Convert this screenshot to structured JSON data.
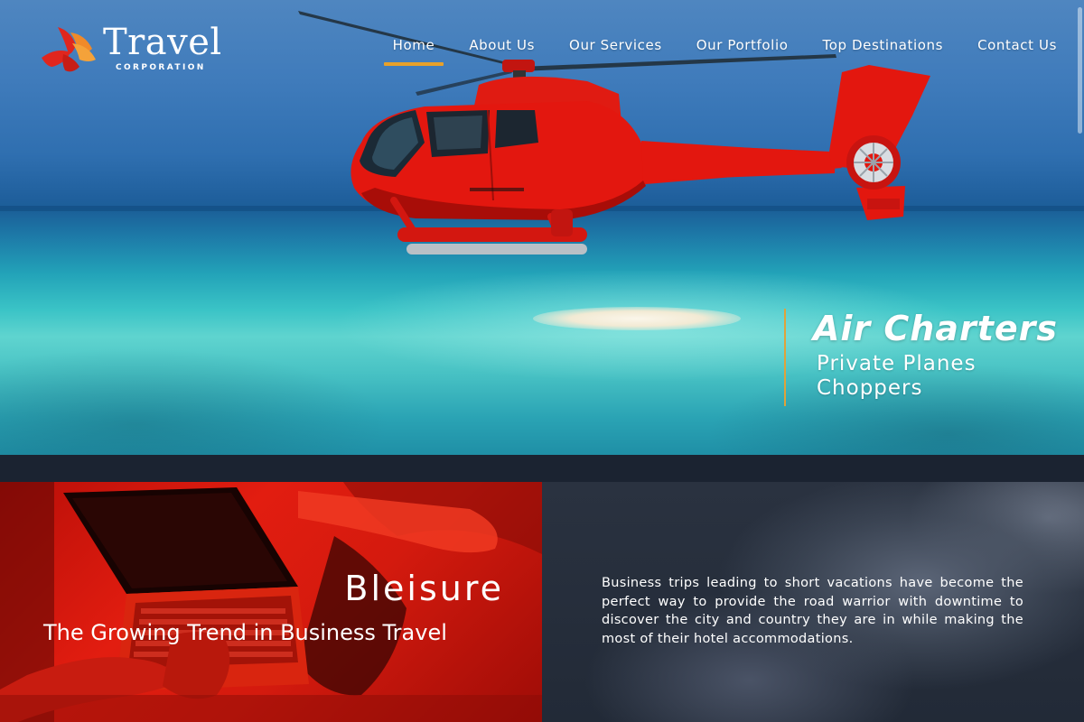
{
  "brand": {
    "name": "Travel",
    "tagline": "CORPORATION",
    "colors": {
      "logo_red": "#e0261e",
      "logo_orange": "#f08a2a",
      "accent_gold": "#e8a12a",
      "panel_red": "#e21d10",
      "dark_bg": "#1b2331"
    }
  },
  "nav": {
    "items": [
      {
        "label": "Home",
        "active": true
      },
      {
        "label": "About Us",
        "active": false
      },
      {
        "label": "Our Services",
        "active": false
      },
      {
        "label": "Our Portfolio",
        "active": false
      },
      {
        "label": "Top Destinations",
        "active": false
      },
      {
        "label": "Contact Us",
        "active": false
      }
    ]
  },
  "hero": {
    "image": "red-helicopter-over-turquoise-sea",
    "caption": {
      "title": "Air Charters",
      "lines": [
        "Private Planes",
        "Choppers"
      ]
    }
  },
  "bleisure": {
    "image": "laptop-on-lap-red-tint",
    "title": "Bleisure",
    "subtitle": "The Growing Trend in Business Travel"
  },
  "info": {
    "image": "storm-clouds-dark",
    "text": "Business trips leading to short vacations have become the perfect way to provide the road warrior with downtime to discover the city and country they are in while making the most of their hotel accommodations."
  }
}
